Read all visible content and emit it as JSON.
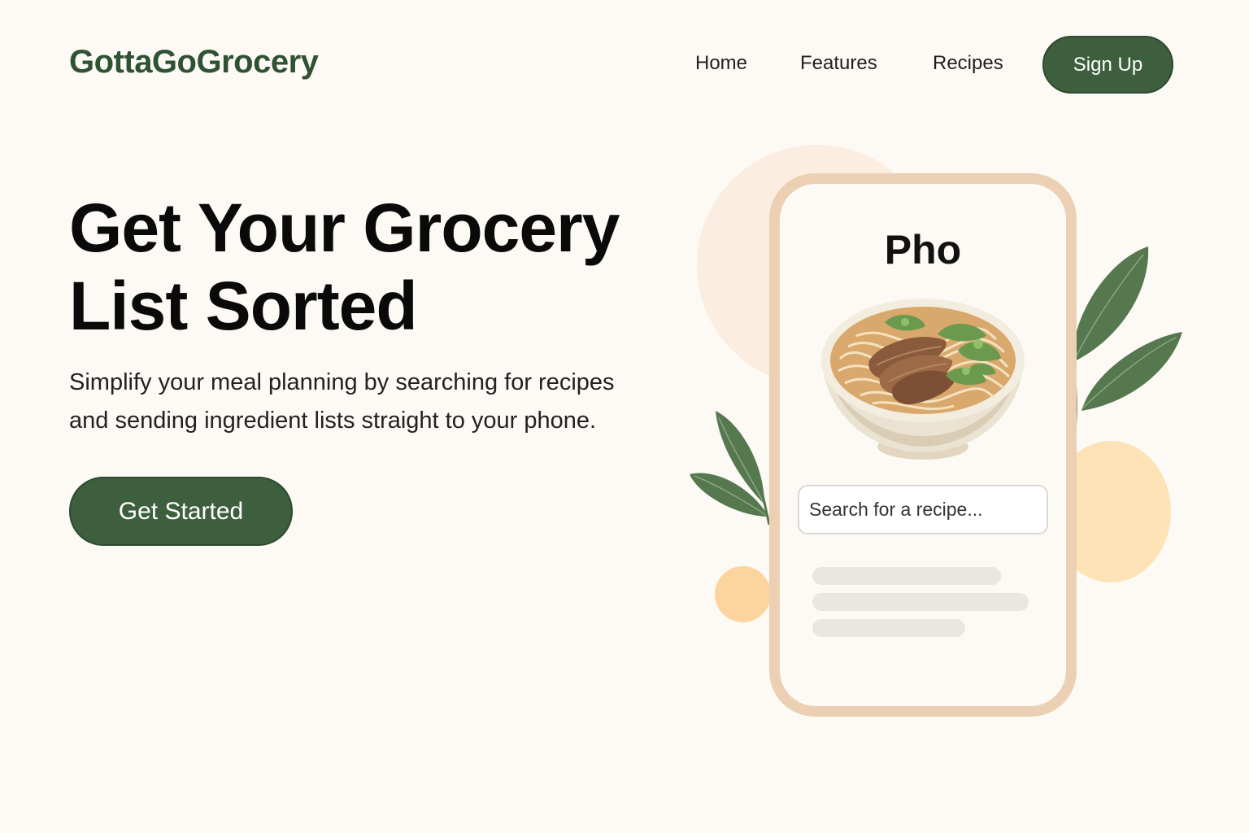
{
  "header": {
    "logo": "GottaGoGrocery",
    "nav": [
      {
        "label": "Home"
      },
      {
        "label": "Features"
      },
      {
        "label": "Recipes"
      }
    ],
    "signup_label": "Sign Up"
  },
  "hero": {
    "title_line1": "Get Your Grocery",
    "title_line2": "List Sorted",
    "subtitle_line1": "Simplify your meal planning by searching for recipes",
    "subtitle_line2": "and sending ingredient lists straight to your phone.",
    "cta_label": "Get Started"
  },
  "phone": {
    "recipe_title": "Pho",
    "image_icon": "pho-bowl-illustration",
    "search": {
      "placeholder": "Search for a recipe...",
      "value": "",
      "icon": "search-icon"
    },
    "placeholder_lines": 3
  },
  "colors": {
    "brand_green": "#3d5f3d",
    "logo_green": "#2f5233",
    "background": "#fdfaf6",
    "phone_frame": "#ecd0b3",
    "accent_peach": "#fde3b5",
    "accent_cream": "#fbeee0",
    "leaf_green": "#55784f"
  }
}
